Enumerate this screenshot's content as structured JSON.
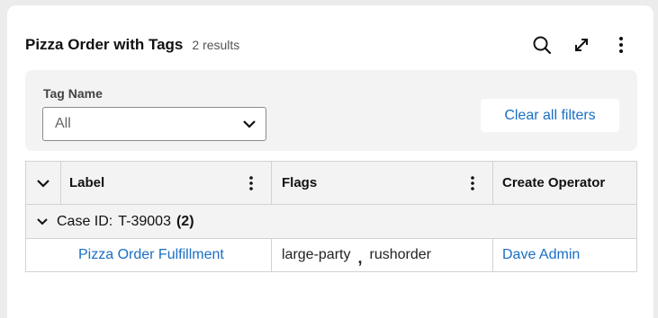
{
  "widget": {
    "title": "Pizza Order with Tags",
    "result_count": "2 results",
    "actions": [
      "search-icon",
      "expand-icon",
      "more-vertical-icon"
    ]
  },
  "filters": {
    "tag_name": {
      "label": "Tag Name",
      "selected": "All"
    },
    "clear_label": "Clear all filters"
  },
  "table": {
    "columns": {
      "label": "Label",
      "flags": "Flags",
      "create_operator": "Create Operator"
    },
    "group": {
      "label": "Case ID:",
      "value": "T-39003",
      "count": "(2)"
    },
    "rows": [
      {
        "label": "Pizza Order Fulfillment",
        "flags": [
          "large-party",
          "rushorder"
        ],
        "flag_separator": ",",
        "create_operator": "Dave Admin"
      }
    ]
  },
  "colors": {
    "link": "#1a6fc4",
    "panel_bg": "#f3f3f3",
    "border": "#d2d2d2"
  }
}
